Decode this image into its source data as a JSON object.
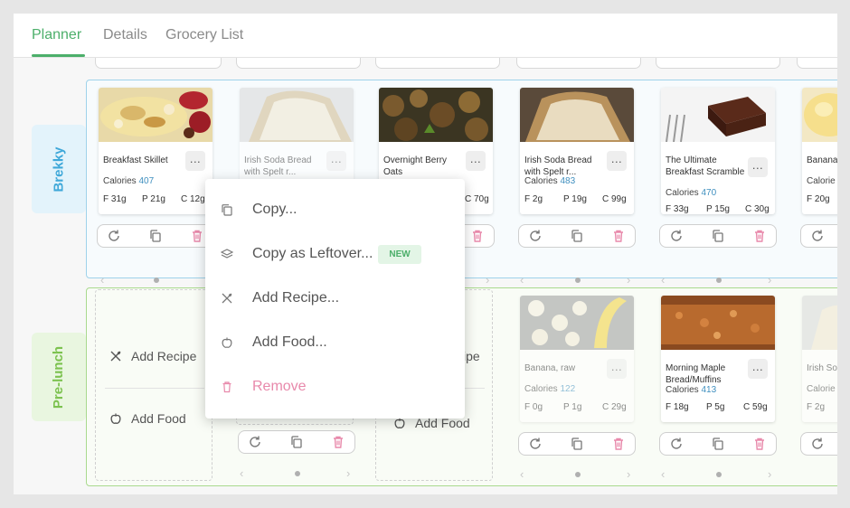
{
  "tabs": [
    {
      "label": "Planner"
    },
    {
      "label": "Details"
    },
    {
      "label": "Grocery List"
    }
  ],
  "meals": {
    "brekky": {
      "label": "Brekky"
    },
    "prelunch": {
      "label": "Pre-lunch"
    }
  },
  "colors": {
    "accent": "#4caf6a",
    "brekky": "#3fa8d9",
    "prelunch": "#7cc24f",
    "calories": "#3f8fbf",
    "danger": "#e889ab"
  },
  "brekky_cards": [
    {
      "title": "Breakfast Skillet",
      "calories_label": "Calories",
      "calories": "407",
      "fat": "F 31g",
      "protein": "P 21g",
      "carbs": "C 12g"
    },
    {
      "title": "Irish Soda Bread with Spelt r...",
      "calories_label": "",
      "calories": "",
      "fat": "",
      "protein": "",
      "carbs": ""
    },
    {
      "title": "Overnight Berry Oats",
      "calories_label": "",
      "calories": "",
      "fat": "",
      "protein": "",
      "carbs": "C 70g"
    },
    {
      "title": "Irish Soda Bread with Spelt r...",
      "calories_label": "Calories",
      "calories": "483",
      "fat": "F 2g",
      "protein": "P 19g",
      "carbs": "C 99g"
    },
    {
      "title": "The Ultimate Breakfast Scramble",
      "calories_label": "Calories",
      "calories": "470",
      "fat": "F 33g",
      "protein": "P 15g",
      "carbs": "C 30g"
    },
    {
      "title": "Banana Muffins",
      "calories_label": "Calorie",
      "calories": "",
      "fat": "F 20g",
      "protein": "",
      "carbs": ""
    }
  ],
  "prelunch_cards": [
    {
      "title": "Banana, raw",
      "calories_label": "Calories",
      "calories": "122",
      "fat": "F 0g",
      "protein": "P 1g",
      "carbs": "C 29g"
    },
    {
      "title": "Morning Maple Bread/Muffins",
      "calories_label": "Calories",
      "calories": "413",
      "fat": "F 18g",
      "protein": "P 5g",
      "carbs": "C 59g"
    },
    {
      "title": "Irish So with Sp",
      "calories_label": "Calorie",
      "calories": "",
      "fat": "F 2g",
      "protein": "",
      "carbs": ""
    }
  ],
  "add_options": {
    "add_recipe": "Add Recipe",
    "add_food": "Add Food",
    "add_recipe_partial": "ipe",
    "add_food_partial": "Add Food"
  },
  "context_menu": {
    "copy": "Copy...",
    "copy_leftover": "Copy as Leftover...",
    "new_badge": "NEW",
    "add_recipe": "Add Recipe...",
    "add_food": "Add Food...",
    "remove": "Remove"
  },
  "icons": {
    "dots": "more-dots-icon",
    "refresh": "refresh-icon",
    "copy": "copy-icon",
    "trash": "trash-icon",
    "utensils": "utensils-icon",
    "apple": "apple-icon",
    "layers": "layers-icon"
  }
}
